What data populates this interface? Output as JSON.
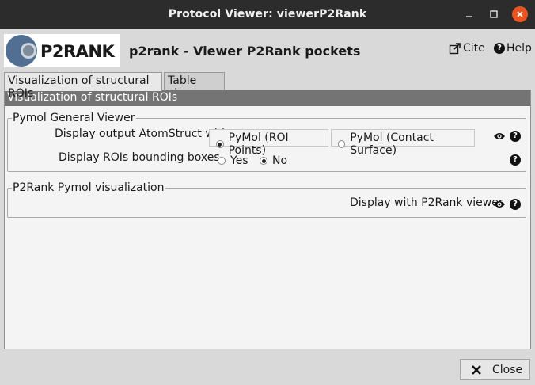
{
  "window": {
    "title": "Protocol Viewer: viewerP2Rank",
    "controls": {
      "minimize": "minimize-icon",
      "maximize": "maximize-icon",
      "close": "close-icon"
    }
  },
  "header": {
    "logo_text": "P2RANK",
    "title": "p2rank - Viewer P2Rank pockets",
    "cite_label": "Cite",
    "help_label": "Help"
  },
  "tabs": [
    {
      "label": "Visualization of structural ROIs",
      "active": true
    },
    {
      "label": "Table view",
      "active": false
    }
  ],
  "panel": {
    "header": "Visualization of structural ROIs",
    "groups": {
      "pymol_general": {
        "legend": "Pymol General Viewer",
        "display_output_label": "Display output AtomStruct with",
        "display_output_options": [
          {
            "label": "PyMol (ROI Points)",
            "selected": true
          },
          {
            "label": "PyMol (Contact Surface)",
            "selected": false
          }
        ],
        "bounding_boxes_label": "Display ROIs bounding boxes",
        "bounding_boxes_options": [
          {
            "label": "Yes",
            "selected": false
          },
          {
            "label": "No",
            "selected": true
          }
        ]
      },
      "p2rank_pymol": {
        "legend": "P2Rank Pymol visualization",
        "display_label": "Display with P2Rank viewer"
      }
    }
  },
  "footer": {
    "close_label": "Close"
  },
  "colors": {
    "titlebar": "#2c2c2c",
    "close_accent": "#e95420",
    "panel_header": "#747474"
  }
}
